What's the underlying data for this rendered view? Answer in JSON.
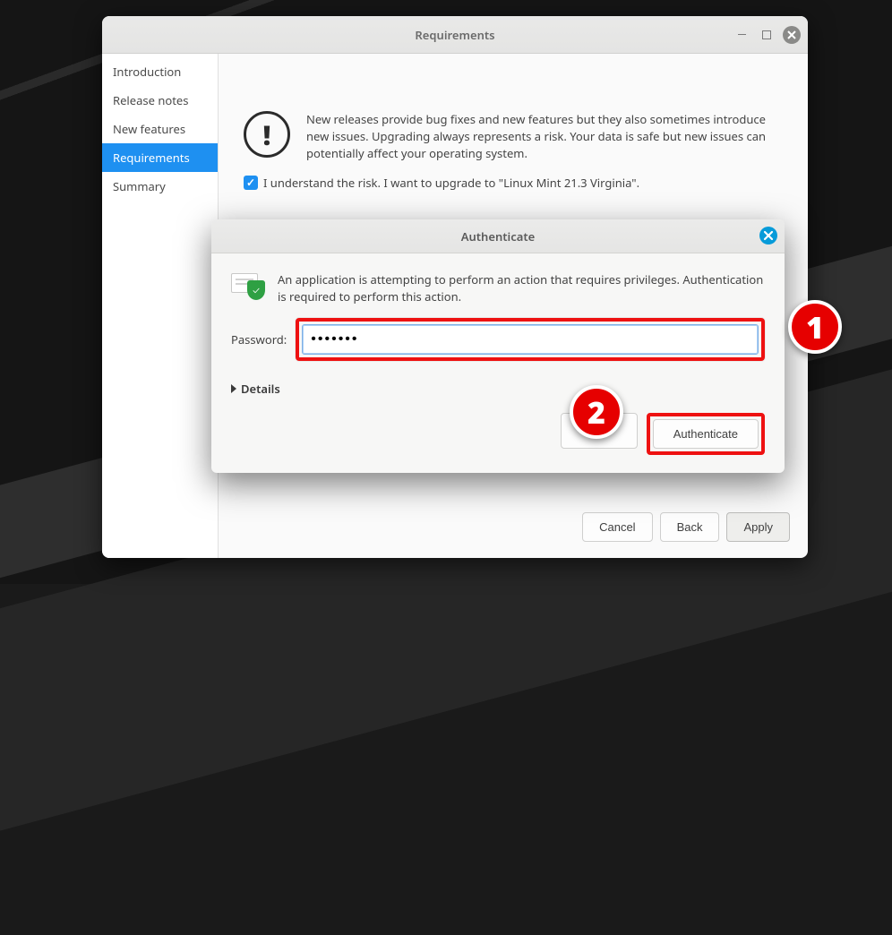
{
  "window": {
    "title": "Requirements"
  },
  "sidebar": {
    "items": [
      "Introduction",
      "Release notes",
      "New features",
      "Requirements",
      "Summary"
    ],
    "selected_index": 3
  },
  "warning": {
    "text": "New releases provide bug fixes and new features but they also sometimes introduce new issues. Upgrading always represents a risk. Your data is safe but new issues can potentially affect your operating system.",
    "ack_label": "I understand the risk. I want to upgrade to \"Linux Mint 21.3 Virginia\".",
    "ack_checked": true
  },
  "dialog": {
    "title": "Authenticate",
    "message": "An application is attempting to perform an action that requires privileges. Authentication is required to perform this action.",
    "password_label": "Password:",
    "password_value": "•••••••",
    "details_label": "Details",
    "authenticate_label": "Authenticate"
  },
  "footer": {
    "cancel": "Cancel",
    "back": "Back",
    "apply": "Apply"
  },
  "annotations": {
    "one": "1",
    "two": "2"
  }
}
